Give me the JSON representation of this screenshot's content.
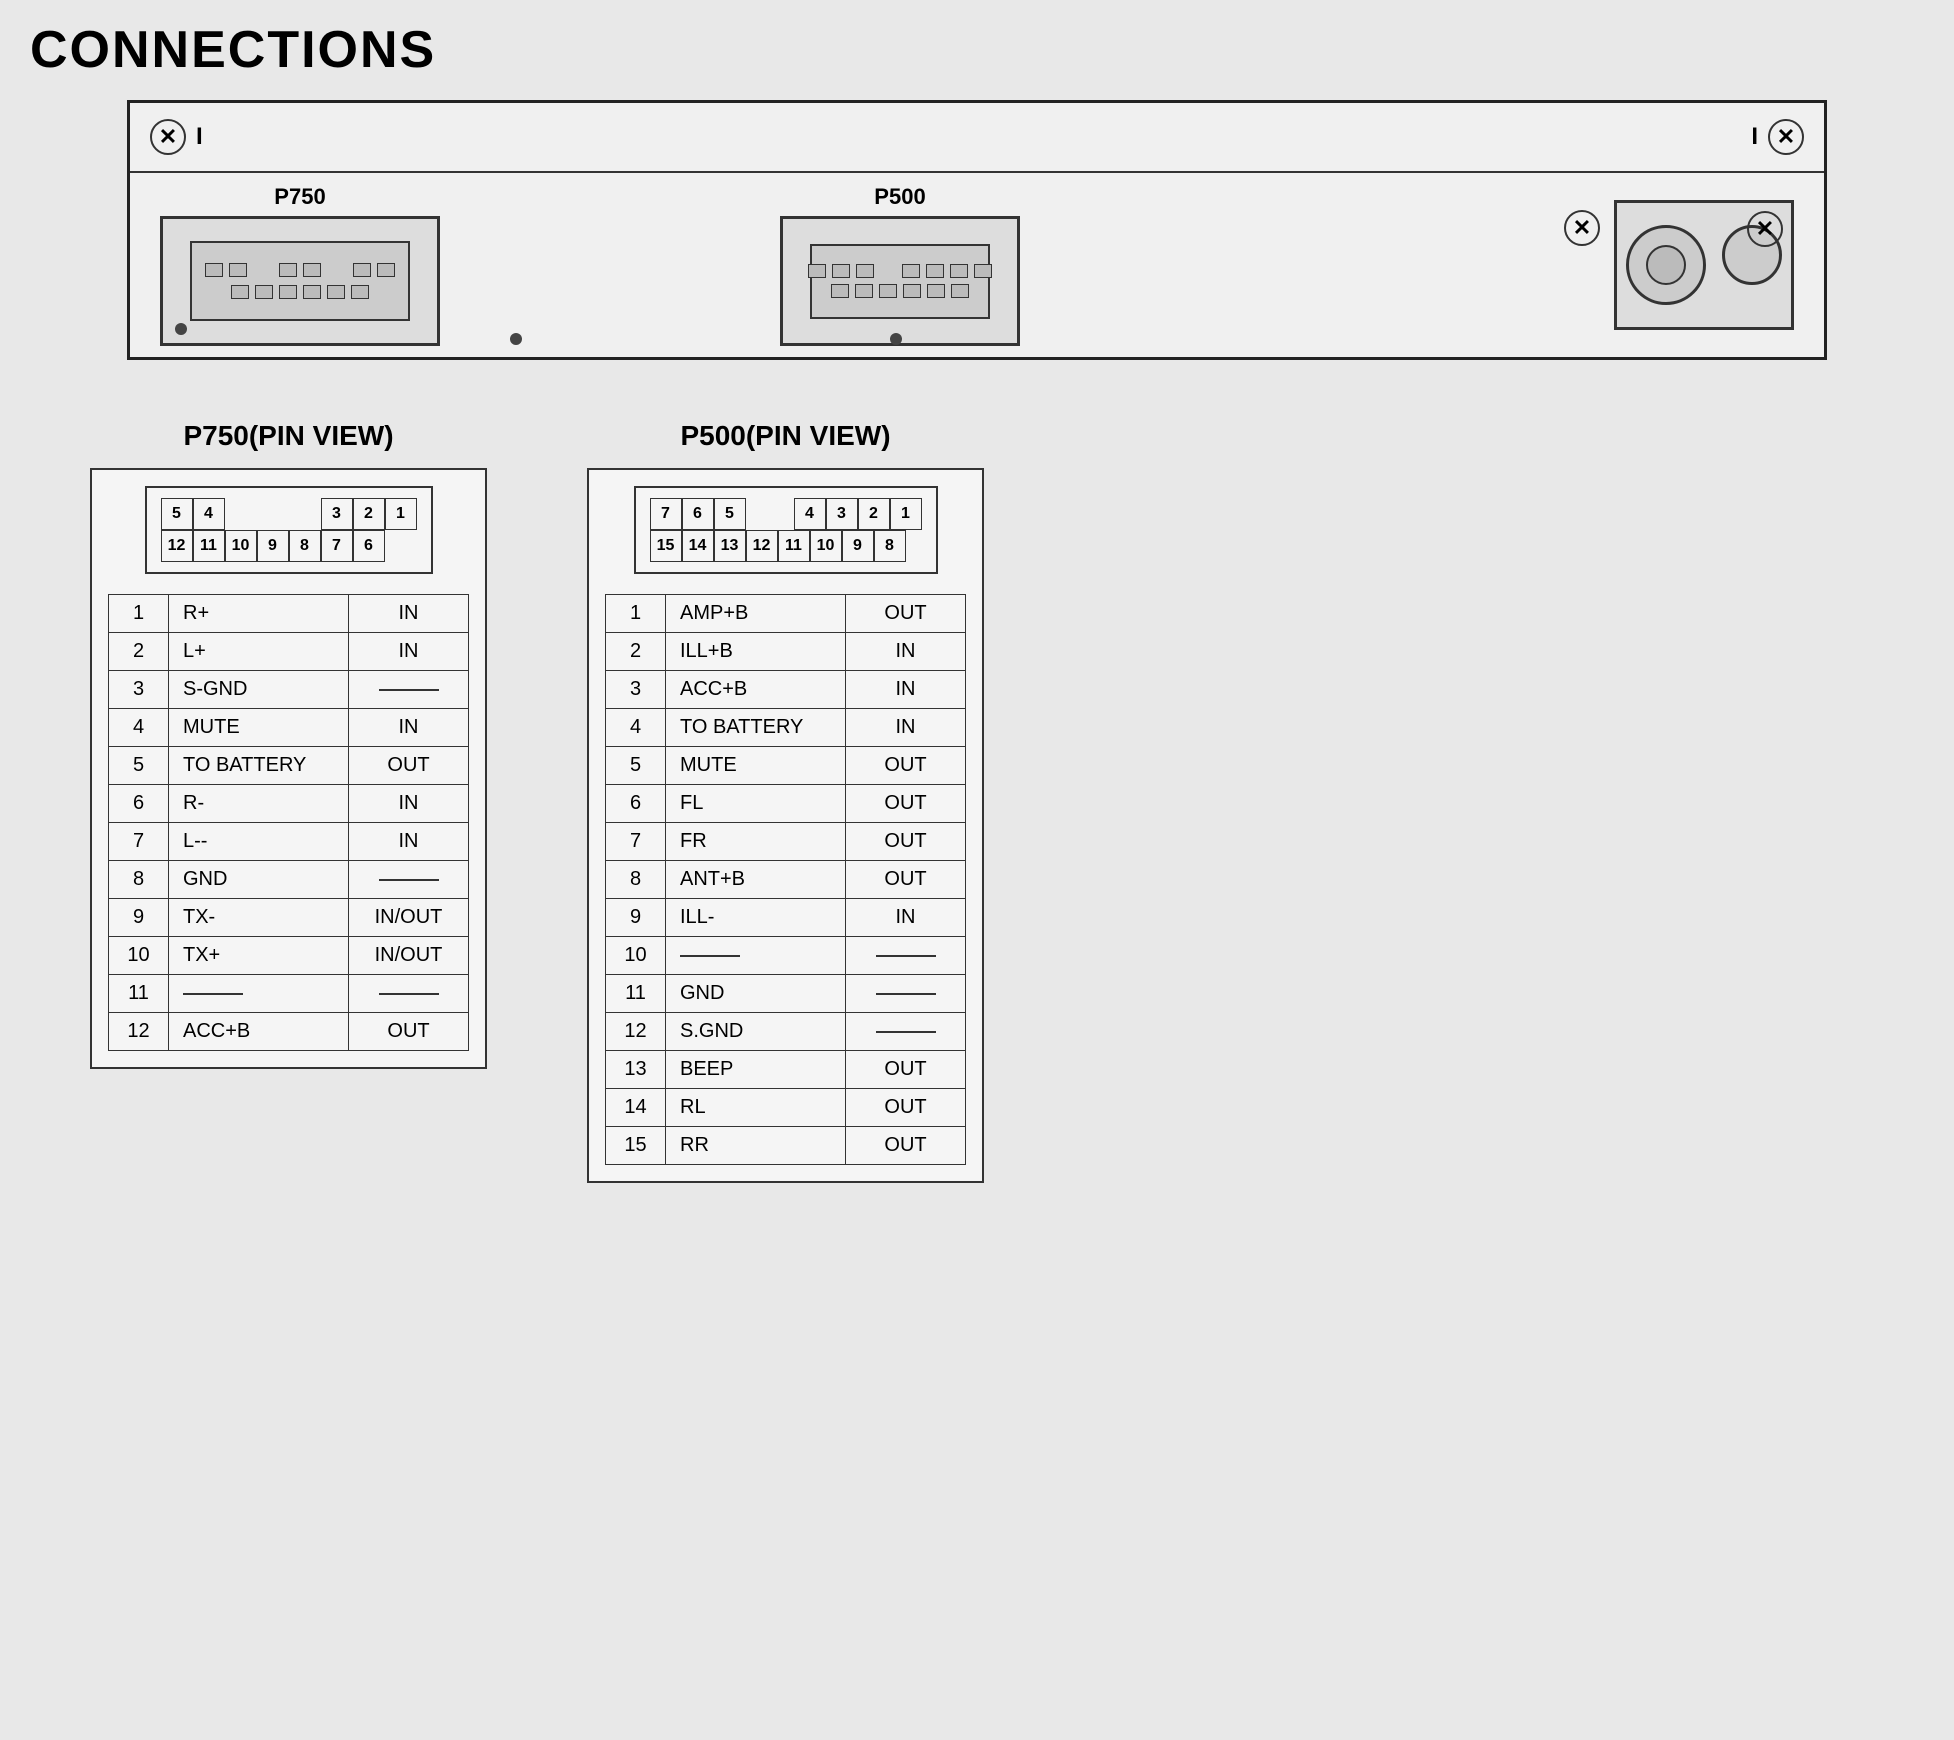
{
  "title": "CONNECTIONS",
  "unit": {
    "p750_label": "P750",
    "p500_label": "P500"
  },
  "p750_view": {
    "title": "P750(PIN VIEW)",
    "top_row": [
      "5",
      "4",
      "",
      "",
      "3",
      "2",
      "1"
    ],
    "bottom_row": [
      "12",
      "11",
      "10",
      "9",
      "8",
      "7",
      "6"
    ],
    "rows": [
      {
        "pin": "1",
        "signal": "R+",
        "dir": "IN"
      },
      {
        "pin": "2",
        "signal": "L+",
        "dir": "IN"
      },
      {
        "pin": "3",
        "signal": "S-GND",
        "dir": "—"
      },
      {
        "pin": "4",
        "signal": "MUTE",
        "dir": "IN"
      },
      {
        "pin": "5",
        "signal": "TO BATTERY",
        "dir": "OUT"
      },
      {
        "pin": "6",
        "signal": "R-",
        "dir": "IN"
      },
      {
        "pin": "7",
        "signal": "L--",
        "dir": "IN"
      },
      {
        "pin": "8",
        "signal": "GND",
        "dir": "—"
      },
      {
        "pin": "9",
        "signal": "TX-",
        "dir": "IN/OUT"
      },
      {
        "pin": "10",
        "signal": "TX+",
        "dir": "IN/OUT"
      },
      {
        "pin": "11",
        "signal": "—",
        "dir": "—"
      },
      {
        "pin": "12",
        "signal": "ACC+B",
        "dir": "OUT"
      }
    ]
  },
  "p500_view": {
    "title": "P500(PIN VIEW)",
    "top_row": [
      "7",
      "6",
      "5",
      "",
      "4",
      "3",
      "2",
      "1"
    ],
    "bottom_row": [
      "15",
      "14",
      "13",
      "12",
      "11",
      "10",
      "9",
      "8"
    ],
    "rows": [
      {
        "pin": "1",
        "signal": "AMP+B",
        "dir": "OUT"
      },
      {
        "pin": "2",
        "signal": "ILL+B",
        "dir": "IN"
      },
      {
        "pin": "3",
        "signal": "ACC+B",
        "dir": "IN"
      },
      {
        "pin": "4",
        "signal": "TO BATTERY",
        "dir": "IN"
      },
      {
        "pin": "5",
        "signal": "MUTE",
        "dir": "OUT"
      },
      {
        "pin": "6",
        "signal": "FL",
        "dir": "OUT"
      },
      {
        "pin": "7",
        "signal": "FR",
        "dir": "OUT"
      },
      {
        "pin": "8",
        "signal": "ANT+B",
        "dir": "OUT"
      },
      {
        "pin": "9",
        "signal": "ILL-",
        "dir": "IN"
      },
      {
        "pin": "10",
        "signal": "—",
        "dir": "—"
      },
      {
        "pin": "11",
        "signal": "GND",
        "dir": "—"
      },
      {
        "pin": "12",
        "signal": "S.GND",
        "dir": "—"
      },
      {
        "pin": "13",
        "signal": "BEEP",
        "dir": "OUT"
      },
      {
        "pin": "14",
        "signal": "RL",
        "dir": "OUT"
      },
      {
        "pin": "15",
        "signal": "RR",
        "dir": "OUT"
      }
    ]
  }
}
